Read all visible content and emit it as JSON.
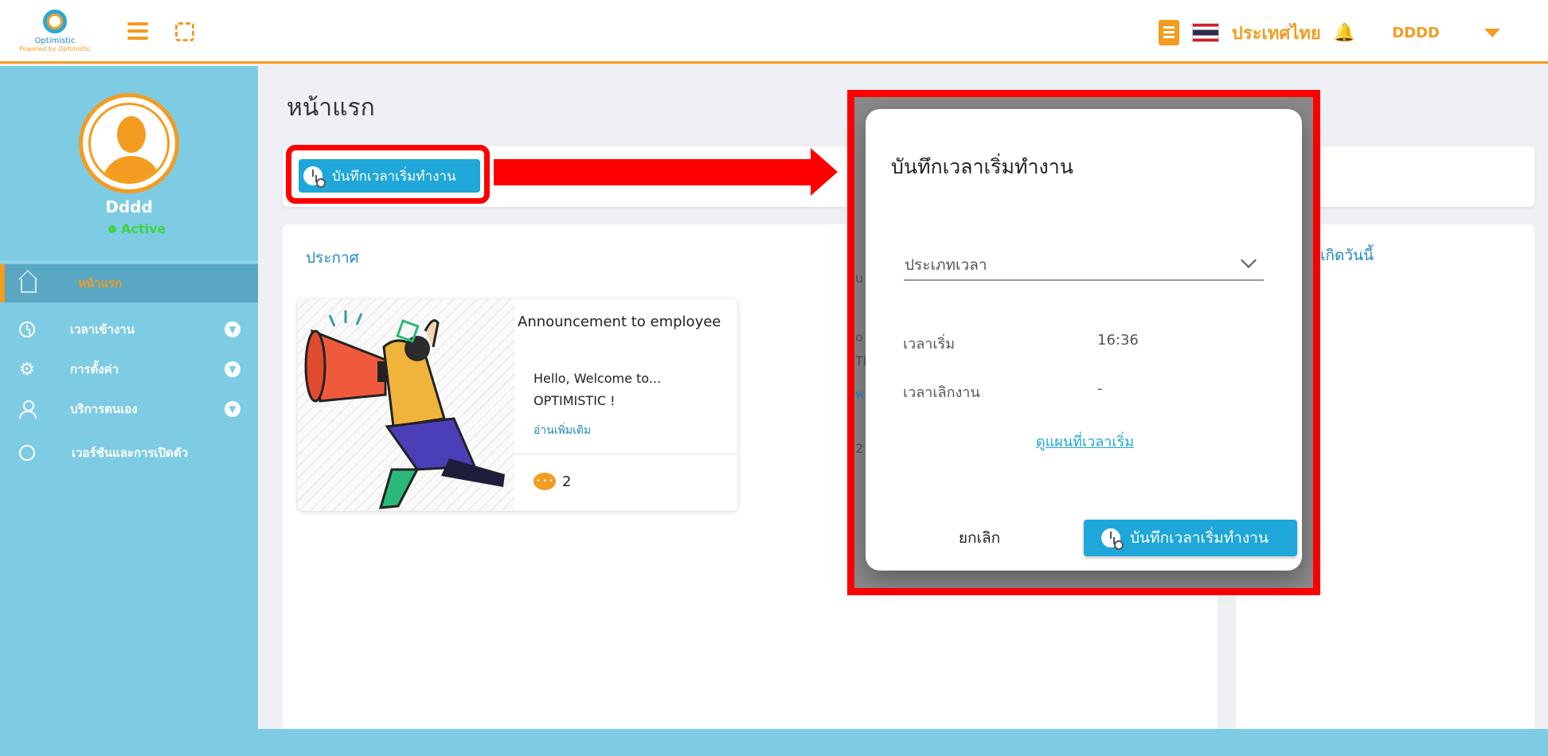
{
  "header": {
    "logo_name": "Optimistic",
    "logo_tagline": "Powered by Optimistic",
    "language": "ประเทศไทย",
    "username": "DDDD"
  },
  "sidebar": {
    "profile_name": "Dddd",
    "status": "Active",
    "items": [
      {
        "label": "หน้าแรก",
        "icon": "home-icon",
        "active": true
      },
      {
        "label": "เวลาเข้างาน",
        "icon": "clock-icon",
        "expandable": true
      },
      {
        "label": "การตั้งค่า",
        "icon": "gear-icon",
        "expandable": true
      },
      {
        "label": "บริการตนเอง",
        "icon": "person-icon",
        "expandable": true
      },
      {
        "label": "เวอร์ชันและการเปิดตัว",
        "icon": "version-icon"
      }
    ]
  },
  "main": {
    "page_title": "หน้าแรก",
    "start_work_button": "บันทึกเวลาเริ่มทำงาน",
    "announcements": {
      "title": "ประกาศ",
      "post": {
        "title": "Announcement to employee",
        "body_line1": "Hello, Welcome to...",
        "body_line2": "OPTIMISTIC !",
        "read_more": "อ่านเพิ่มเติม",
        "comment_count": "2",
        "comment_icon_text": "• • •"
      }
    },
    "birthday_title": "เกิดวันนี้"
  },
  "modal": {
    "title": "บันทึกเวลาเริ่มทำงาน",
    "time_type_placeholder": "ประเภทเวลา",
    "start_label": "เวลาเริ่ม",
    "start_value": "16:36",
    "end_label": "เวลาเลิกงาน",
    "end_value": "-",
    "map_link": "ดูแผนที่เวลาเริ่ม",
    "cancel": "ยกเลิก",
    "confirm": "บันทึกเวลาเริ่มทำงาน",
    "background_fragments": [
      "u",
      "o",
      "TI",
      "พ",
      "2"
    ]
  },
  "colors": {
    "accent_orange": "#f39c1f",
    "primary_blue": "#1ea7d8",
    "sidebar_blue": "#7ecbe4",
    "highlight_red": "#ff0000"
  }
}
